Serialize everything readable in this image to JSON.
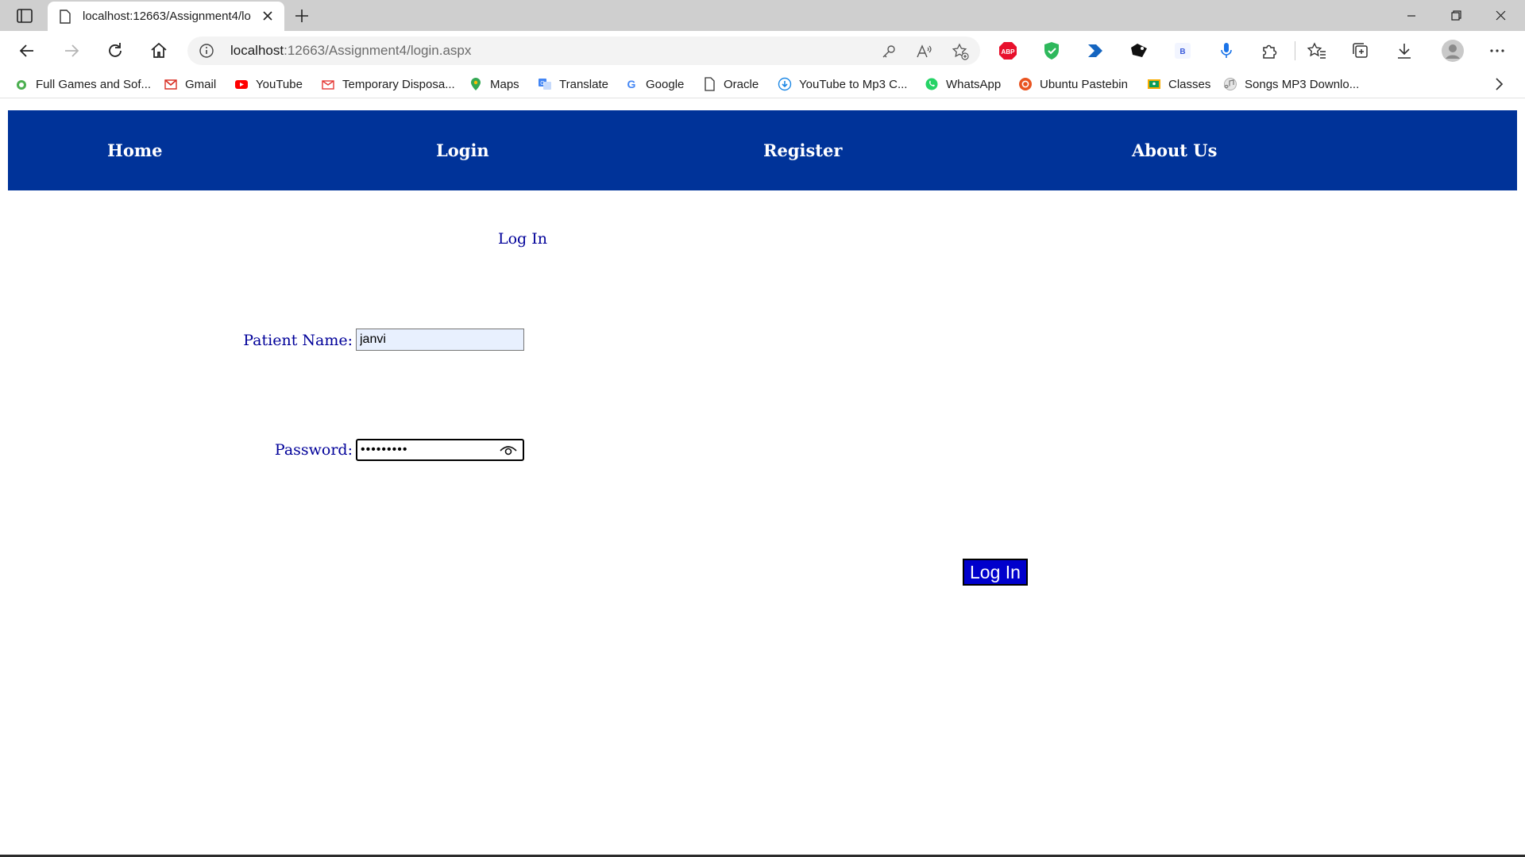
{
  "browser": {
    "tab_title": "localhost:12663/Assignment4/lo",
    "url_host": "localhost",
    "url_path": ":12663/Assignment4/login.aspx",
    "bookmarks": [
      {
        "label": "Full Games and Sof...",
        "icon": "gamepad-icon",
        "color": "#4caf50"
      },
      {
        "label": "Gmail",
        "icon": "gmail-icon",
        "color": "#d93025"
      },
      {
        "label": "YouTube",
        "icon": "youtube-icon",
        "color": "#ff0000"
      },
      {
        "label": "Temporary Disposa...",
        "icon": "mail-icon",
        "color": "#e53935"
      },
      {
        "label": "Maps",
        "icon": "maps-pin-icon",
        "color": "#34a853"
      },
      {
        "label": "Translate",
        "icon": "translate-icon",
        "color": "#4285f4"
      },
      {
        "label": "Google",
        "icon": "google-icon",
        "color": "#4285f4"
      },
      {
        "label": "Oracle",
        "icon": "page-icon",
        "color": "#555555"
      },
      {
        "label": "YouTube to Mp3 C...",
        "icon": "download-cloud-icon",
        "color": "#1e88e5"
      },
      {
        "label": "WhatsApp",
        "icon": "whatsapp-icon",
        "color": "#25d366"
      },
      {
        "label": "Ubuntu Pastebin",
        "icon": "ubuntu-icon",
        "color": "#e95420"
      },
      {
        "label": "Classes",
        "icon": "classroom-icon",
        "color": "#f9ab00"
      },
      {
        "label": "Songs MP3 Downlo...",
        "icon": "music-icon",
        "color": "#b0b0b0"
      }
    ]
  },
  "nav": {
    "home": "Home",
    "login": "Login",
    "register": "Register",
    "about": "About Us"
  },
  "form": {
    "heading": "Log In",
    "patient_name_label": "Patient Name:",
    "patient_name_value": "janvi",
    "password_label": "Password:",
    "password_masked": "•••••••••",
    "submit_label": "Log In"
  },
  "colors": {
    "nav_background": "#003399",
    "label_text": "#000099",
    "button_background": "#0000cc"
  }
}
